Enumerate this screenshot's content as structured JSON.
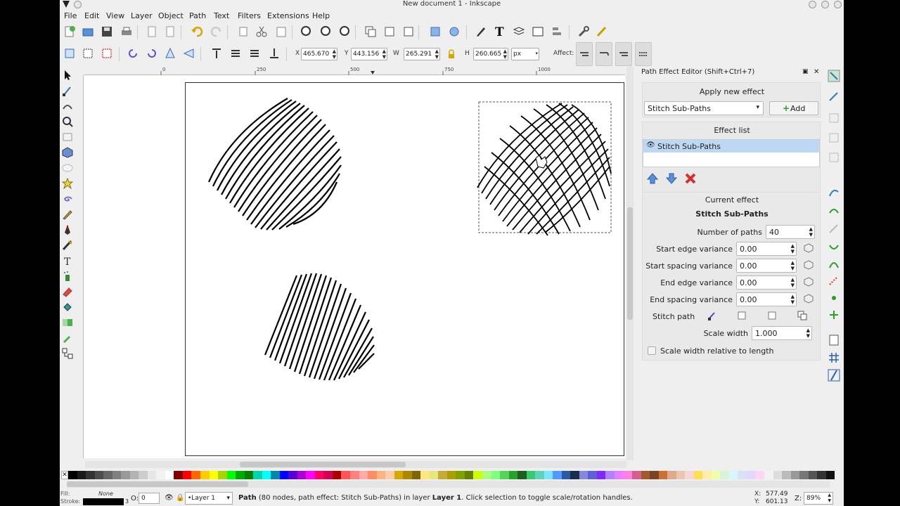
{
  "window": {
    "title": "New document 1 - Inkscape"
  },
  "menu": [
    "File",
    "Edit",
    "View",
    "Layer",
    "Object",
    "Path",
    "Text",
    "Filters",
    "Extensions",
    "Help"
  ],
  "toolbar": {
    "x_label": "X",
    "x_value": "465.670",
    "y_label": "Y",
    "y_value": "443.156",
    "w_label": "W",
    "w_value": "265.291",
    "h_label": "H",
    "h_value": "260.665",
    "unit": "px",
    "affect_label": "Affect:"
  },
  "ruler": {
    "marks": [
      "0",
      "250",
      "500",
      "750",
      "1000"
    ]
  },
  "panel": {
    "title": "Path Effect Editor (Shift+Ctrl+7)",
    "apply_header": "Apply new effect",
    "effect_select": "Stitch Sub-Paths",
    "add_label": "Add",
    "list_header": "Effect list",
    "list_items": [
      "Stitch Sub-Paths"
    ],
    "current_header": "Current effect",
    "current_name": "Stitch Sub-Paths",
    "params": [
      {
        "label": "Number of paths",
        "value": "40"
      },
      {
        "label": "Start edge variance",
        "value": "0.00"
      },
      {
        "label": "Start spacing variance",
        "value": "0.00"
      },
      {
        "label": "End edge variance",
        "value": "0.00"
      },
      {
        "label": "End spacing variance",
        "value": "0.00"
      }
    ],
    "stitch_path_label": "Stitch path",
    "scale_width_label": "Scale width",
    "scale_width_value": "1.000",
    "scale_relative_label": "Scale width relative to length"
  },
  "status": {
    "fill_label": "Fill:",
    "fill_value": "None",
    "stroke_label": "Stroke:",
    "stroke_width": "3",
    "opacity_label": "O:",
    "opacity_value": "0",
    "layer": "•Layer 1",
    "message_bold": "Path",
    "message_a": " (80 nodes, path effect: Stitch Sub-Paths) in layer ",
    "message_layer": "Layer 1",
    "message_b": ". Click selection to toggle scale/rotation handles.",
    "x_coord": "577.49",
    "y_coord": "601.13",
    "zoom_label": "Z:",
    "zoom_value": "89%"
  },
  "palette": [
    "#000000",
    "#1a1a1a",
    "#333333",
    "#4d4d4d",
    "#666666",
    "#808080",
    "#999999",
    "#b3b3b3",
    "#cccccc",
    "#e6e6e6",
    "#f2f2f2",
    "#ffffff",
    "#800000",
    "#ff0000",
    "#ff6600",
    "#ffcc00",
    "#ffff00",
    "#aad400",
    "#00ff00",
    "#00aa00",
    "#008000",
    "#00d4aa",
    "#00ffff",
    "#0088aa",
    "#0000ff",
    "#5500d4",
    "#aa00d4",
    "#ff00ff",
    "#ff0066",
    "#d40055",
    "#aa0000",
    "#ff5555",
    "#ff8080",
    "#ffaaaa",
    "#ff8c66",
    "#ffb380",
    "#ffccaa",
    "#d4aa00",
    "#aa8800",
    "#806600",
    "#ffe680",
    "#e6e680",
    "#c8ab37",
    "#aaa000",
    "#80a000",
    "#668000",
    "#ccff00",
    "#aaff80",
    "#80ff80",
    "#55d455",
    "#2ca02c",
    "#1e5e1e",
    "#37c871",
    "#5fd3bc",
    "#80e5ff",
    "#5599ff",
    "#2c5aa0",
    "#162d50",
    "#8787de",
    "#5f5fd3",
    "#7f2aff",
    "#b380ff",
    "#e580ff",
    "#ff80e5",
    "#d35f8d",
    "#a05a2c",
    "#784421",
    "#c87137",
    "#deaa87",
    "#e9c6af",
    "#f4d7d7",
    "#ffdd55",
    "#ffeeaa",
    "#eeffaa",
    "#d7f4d7",
    "#d5f6ff",
    "#d7e3f4",
    "#e5d5ff",
    "#ffd5f6",
    "#f2f2f2",
    "#dddddd",
    "#bbbbbb",
    "#999999",
    "#777777",
    "#555555",
    "#333333",
    "#111111"
  ]
}
